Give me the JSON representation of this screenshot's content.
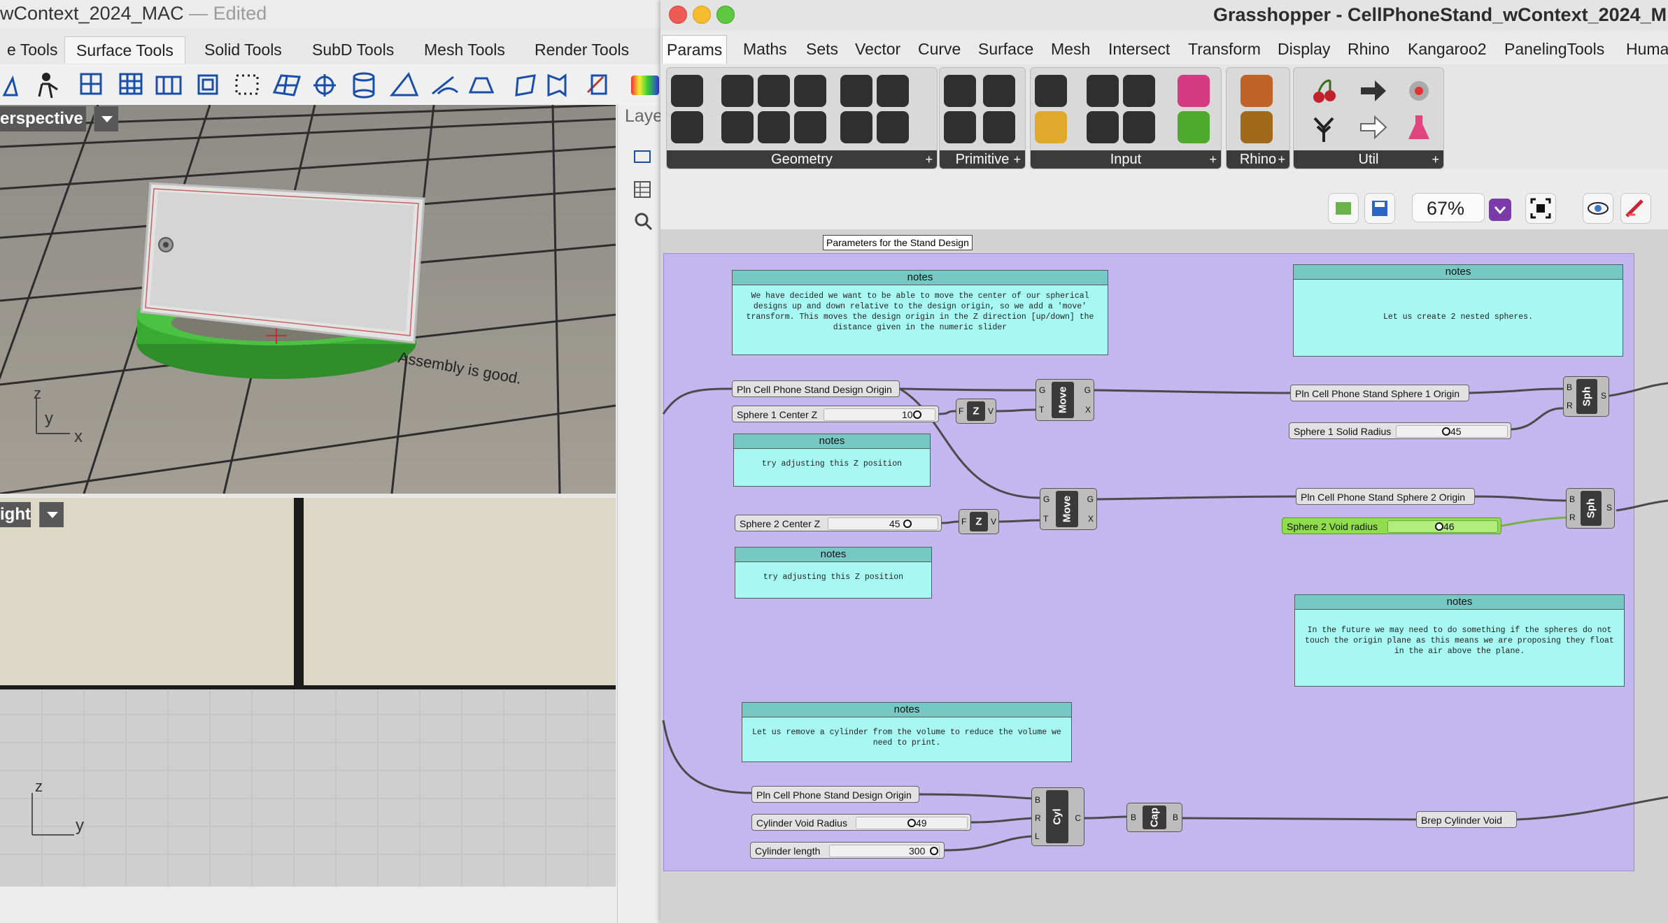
{
  "rhino": {
    "title": "wContext_2024_MAC",
    "edited": "— Edited",
    "tabs": [
      "e Tools",
      "Surface Tools",
      "Solid Tools",
      "SubD Tools",
      "Mesh Tools",
      "Render Tools"
    ],
    "active_tab": "Surface Tools",
    "viewport_top": {
      "label": "erspective",
      "annotation": "Assembly is good.",
      "axes": {
        "x": "x",
        "y": "y",
        "z": "z"
      }
    },
    "viewport_bottom": {
      "label": "ight",
      "axes": {
        "z": "z",
        "y": "y"
      }
    },
    "layers_label": "Laye"
  },
  "grasshopper": {
    "title": "Grasshopper - CellPhoneStand_wContext_2024_M",
    "menu": [
      "Params",
      "Maths",
      "Sets",
      "Vector",
      "Curve",
      "Surface",
      "Mesh",
      "Intersect",
      "Transform",
      "Display",
      "Rhino",
      "Kangaroo2",
      "PanelingTools",
      "Human"
    ],
    "active_menu": "Params",
    "ribbon_groups": [
      "Geometry",
      "Primitive",
      "Input",
      "Rhino",
      "Util"
    ],
    "zoom": "67%",
    "group_label": "Parameters for the Stand Design",
    "colors": {
      "group": "#c4b7ef",
      "panel": "#a7f7f2",
      "slider_active": "#8fdc4c",
      "zoom_accent": "#7a3aa7"
    },
    "panels": [
      {
        "title": "notes",
        "text": "We have decided we want to be able to move the center of our spherical designs up and down relative to the design origin, so we add a 'move' transform. This moves the design origin in the Z direction [up/down] the distance given in the numeric slider"
      },
      {
        "title": "notes",
        "text": "Let us create 2 nested spheres."
      },
      {
        "title": "notes",
        "text": "try adjusting this Z position"
      },
      {
        "title": "notes",
        "text": "try adjusting this Z position"
      },
      {
        "title": "notes",
        "text": "In the future we may need to do something if the spheres do not touch the origin plane as this means we are proposing they float in the air above the plane."
      },
      {
        "title": "notes",
        "text": "Let us remove a cylinder from the volume to reduce the volume we need to print."
      }
    ],
    "params": {
      "pln_origin_1": "Pln Cell Phone Stand Design Origin",
      "pln_sphere1": "Pln Cell Phone Stand Sphere 1 Origin",
      "pln_sphere2": "Pln Cell Phone Stand Sphere 2 Origin",
      "pln_origin_2": "Pln Cell Phone Stand Design Origin",
      "brep_cyl": "Brep Cylinder Void"
    },
    "sliders": {
      "s1z": {
        "name": "Sphere 1 Center Z",
        "value": "10"
      },
      "s2z": {
        "name": "Sphere 2 Center Z",
        "value": "45"
      },
      "s1r": {
        "name": "Sphere 1 Solid Radius",
        "value": "45"
      },
      "s2r": {
        "name": "Sphere 2 Void radius",
        "value": "46"
      },
      "cylr": {
        "name": "Cylinder Void  Radius",
        "value": "49"
      },
      "cyll": {
        "name": "Cylinder length",
        "value": "300"
      }
    },
    "components": {
      "move": "Move",
      "unitz": "Z",
      "sph": "Sph",
      "cyl": "Cyl",
      "cap": "Cap",
      "ports": {
        "G": "G",
        "T": "T",
        "X": "X",
        "F": "F",
        "V": "V",
        "B": "B",
        "R": "R",
        "S": "S",
        "L": "L",
        "C": "C"
      }
    }
  }
}
